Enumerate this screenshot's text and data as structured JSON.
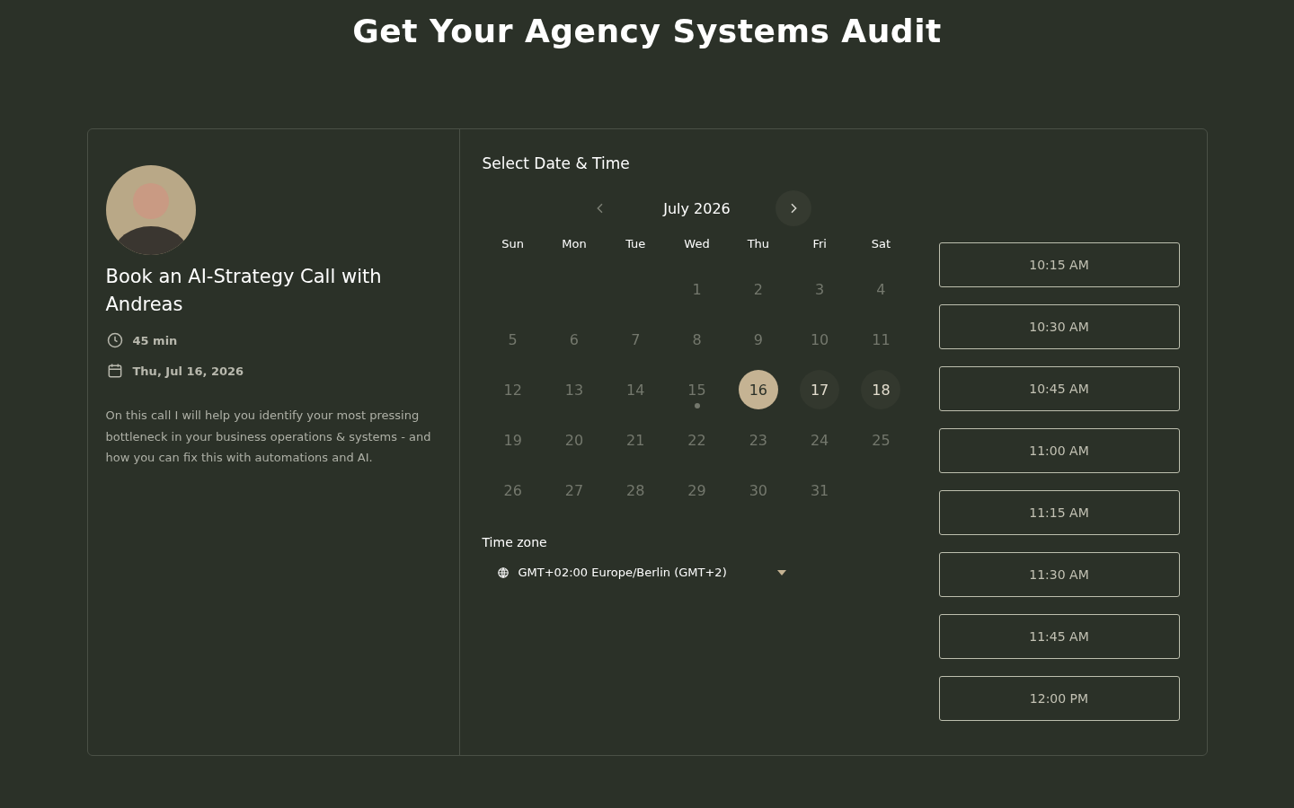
{
  "page_title": "Get Your Agency Systems Audit",
  "host": {
    "title": "Book an AI-Strategy Call with Andreas",
    "duration": "45 min",
    "date": "Thu, Jul 16, 2026",
    "description": "On this call I will help you identify your most pressing bottleneck in your business operations & systems - and how you can fix this with automations and AI."
  },
  "calendar": {
    "heading": "Select Date & Time",
    "month": "July 2026",
    "prev_disabled": true,
    "weekdays": [
      "Sun",
      "Mon",
      "Tue",
      "Wed",
      "Thu",
      "Fri",
      "Sat"
    ],
    "weeks": [
      [
        {
          "kind": "blank"
        },
        {
          "kind": "blank"
        },
        {
          "kind": "blank"
        },
        {
          "kind": "day",
          "label": "1",
          "selected": false,
          "available": false,
          "today": false
        },
        {
          "kind": "day",
          "label": "2",
          "selected": false,
          "available": false,
          "today": false
        },
        {
          "kind": "day",
          "label": "3",
          "selected": false,
          "available": false,
          "today": false
        },
        {
          "kind": "day",
          "label": "4",
          "selected": false,
          "available": false,
          "today": false
        }
      ],
      [
        {
          "kind": "day",
          "label": "5",
          "selected": false,
          "available": false,
          "today": false
        },
        {
          "kind": "day",
          "label": "6",
          "selected": false,
          "available": false,
          "today": false
        },
        {
          "kind": "day",
          "label": "7",
          "selected": false,
          "available": false,
          "today": false
        },
        {
          "kind": "day",
          "label": "8",
          "selected": false,
          "available": false,
          "today": false
        },
        {
          "kind": "day",
          "label": "9",
          "selected": false,
          "available": false,
          "today": false
        },
        {
          "kind": "day",
          "label": "10",
          "selected": false,
          "available": false,
          "today": false
        },
        {
          "kind": "day",
          "label": "11",
          "selected": false,
          "available": false,
          "today": false
        }
      ],
      [
        {
          "kind": "day",
          "label": "12",
          "selected": false,
          "available": false,
          "today": false
        },
        {
          "kind": "day",
          "label": "13",
          "selected": false,
          "available": false,
          "today": false
        },
        {
          "kind": "day",
          "label": "14",
          "selected": false,
          "available": false,
          "today": false
        },
        {
          "kind": "day",
          "label": "15",
          "selected": false,
          "available": false,
          "today": true
        },
        {
          "kind": "day",
          "label": "16",
          "selected": true,
          "available": true,
          "today": false
        },
        {
          "kind": "day",
          "label": "17",
          "selected": false,
          "available": true,
          "today": false
        },
        {
          "kind": "day",
          "label": "18",
          "selected": false,
          "available": true,
          "today": false
        }
      ],
      [
        {
          "kind": "day",
          "label": "19",
          "selected": false,
          "available": false,
          "today": false
        },
        {
          "kind": "day",
          "label": "20",
          "selected": false,
          "available": false,
          "today": false
        },
        {
          "kind": "day",
          "label": "21",
          "selected": false,
          "available": false,
          "today": false
        },
        {
          "kind": "day",
          "label": "22",
          "selected": false,
          "available": false,
          "today": false
        },
        {
          "kind": "day",
          "label": "23",
          "selected": false,
          "available": false,
          "today": false
        },
        {
          "kind": "day",
          "label": "24",
          "selected": false,
          "available": false,
          "today": false
        },
        {
          "kind": "day",
          "label": "25",
          "selected": false,
          "available": false,
          "today": false
        }
      ],
      [
        {
          "kind": "day",
          "label": "26",
          "selected": false,
          "available": false,
          "today": false
        },
        {
          "kind": "day",
          "label": "27",
          "selected": false,
          "available": false,
          "today": false
        },
        {
          "kind": "day",
          "label": "28",
          "selected": false,
          "available": false,
          "today": false
        },
        {
          "kind": "day",
          "label": "29",
          "selected": false,
          "available": false,
          "today": false
        },
        {
          "kind": "day",
          "label": "30",
          "selected": false,
          "available": false,
          "today": false
        },
        {
          "kind": "day",
          "label": "31",
          "selected": false,
          "available": false,
          "today": false
        },
        {
          "kind": "blank"
        }
      ]
    ]
  },
  "timezone": {
    "label": "Time zone",
    "value": "GMT+02:00 Europe/Berlin (GMT+2)"
  },
  "time_slots": [
    "10:15 AM",
    "10:30 AM",
    "10:45 AM",
    "11:00 AM",
    "11:15 AM",
    "11:30 AM",
    "11:45 AM",
    "12:00 PM"
  ]
}
